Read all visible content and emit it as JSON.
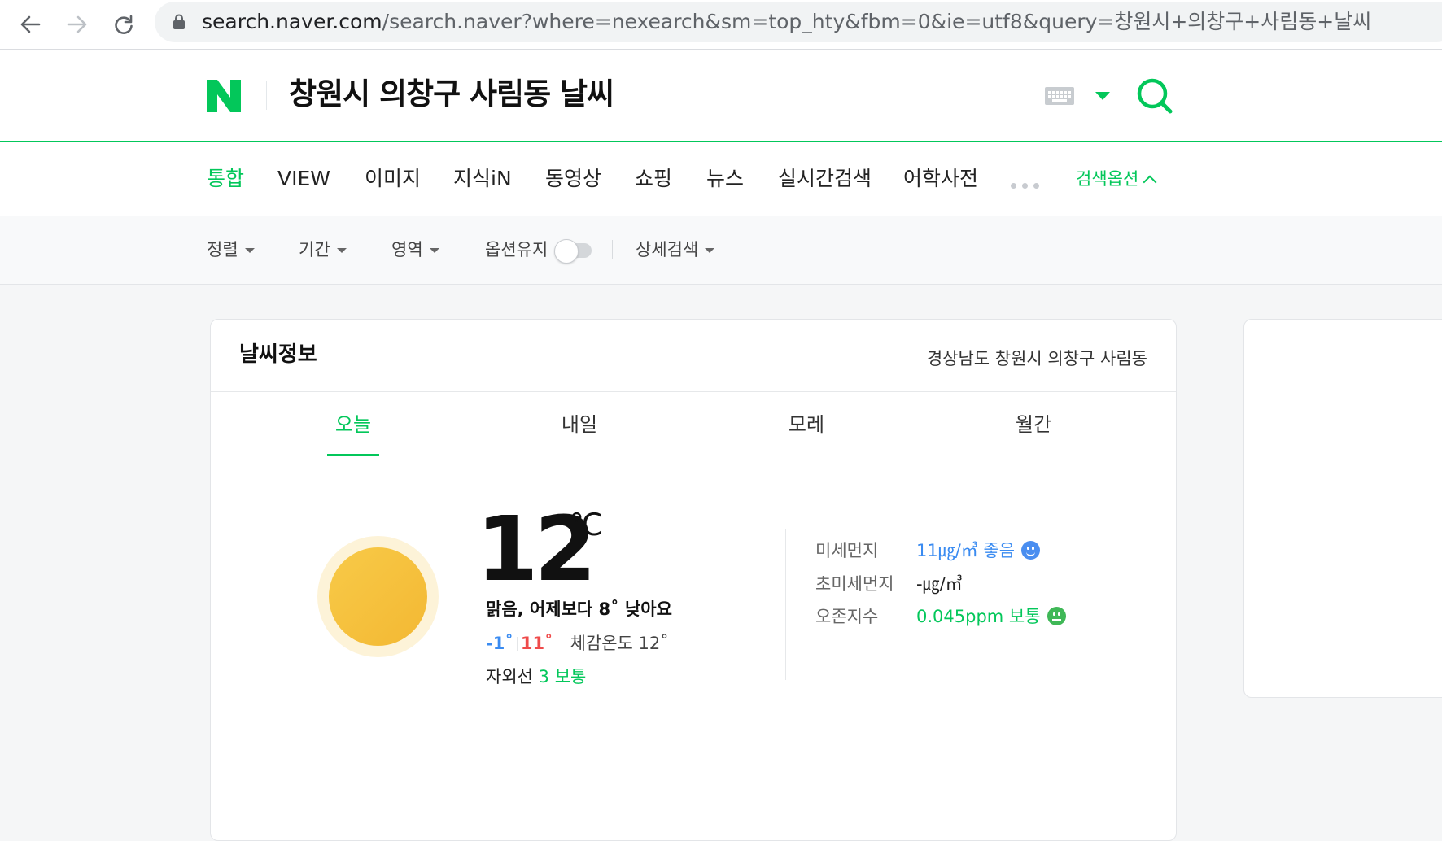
{
  "browser": {
    "url_host": "search.naver.com",
    "url_rest": "/search.naver?where=nexearch&sm=top_hty&fbm=0&ie=utf8&query=창원시+의창구+사림동+날씨"
  },
  "header": {
    "query": "창원시 의창구 사림동 날씨",
    "brand_color": "#03c75a"
  },
  "tabs": [
    {
      "label": "통합"
    },
    {
      "label": "VIEW"
    },
    {
      "label": "이미지"
    },
    {
      "label": "지식iN"
    },
    {
      "label": "동영상"
    },
    {
      "label": "쇼핑"
    },
    {
      "label": "뉴스"
    },
    {
      "label": "실시간검색"
    },
    {
      "label": "어학사전"
    }
  ],
  "search_options_label": "검색옵션",
  "filters": {
    "sort": "정렬",
    "period": "기간",
    "area": "영역",
    "keep_option": "옵션유지",
    "detail": "상세검색"
  },
  "weather": {
    "title": "날씨정보",
    "location": "경상남도 창원시 의창구 사림동",
    "day_tabs": [
      "오늘",
      "내일",
      "모레",
      "월간"
    ],
    "temperature": "12",
    "unit": "℃",
    "summary": "맑음, 어제보다 8˚ 낮아요",
    "min": "-1˚",
    "max": "11˚",
    "feels_like": "체감온도 12˚",
    "uv_label": "자외선",
    "uv_value": "3 보통",
    "air": [
      {
        "label": "미세먼지",
        "value": "11㎍/㎥ 좋음"
      },
      {
        "label": "초미세먼지",
        "value": "-㎍/㎥"
      },
      {
        "label": "오존지수",
        "value": "0.045ppm 보통"
      }
    ]
  }
}
